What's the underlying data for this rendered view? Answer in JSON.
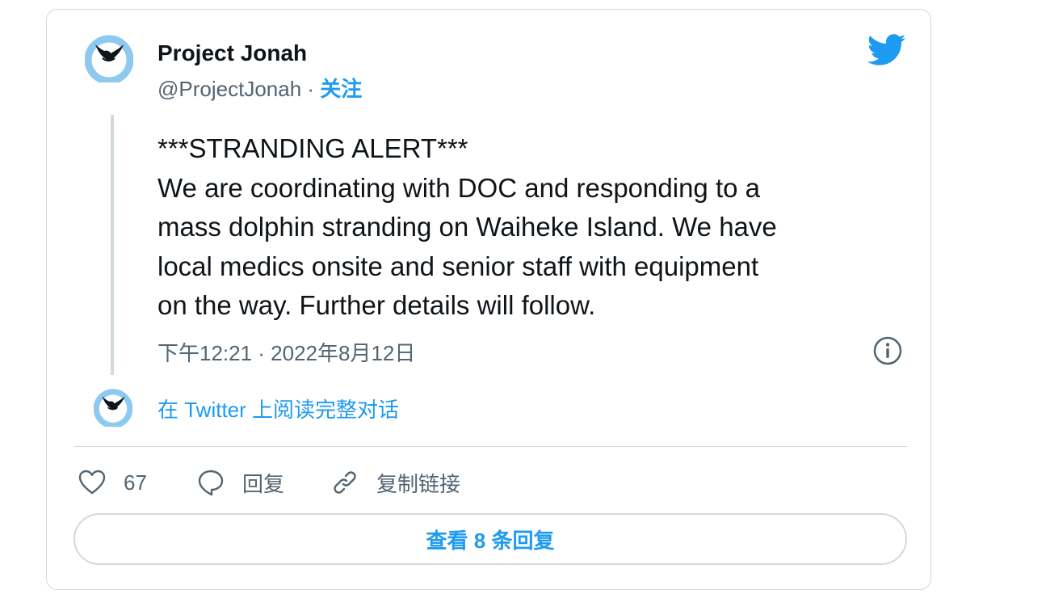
{
  "tweet": {
    "author_name": "Project Jonah",
    "handle": "@ProjectJonah",
    "separator": " · ",
    "follow_label": "关注",
    "text_lines": [
      "***STRANDING ALERT***",
      "We are coordinating with DOC and responding to a",
      "mass dolphin stranding on Waiheke Island. We have",
      "local medics onsite and senior staff with equipment",
      "on the way. Further details will follow."
    ],
    "timestamp": "下午12:21 · 2022年8月12日",
    "read_more": "在 Twitter 上阅读完整对话",
    "actions": {
      "like_count": "67",
      "reply_label": "回复",
      "copy_link_label": "复制链接"
    },
    "view_replies_label": "查看 8 条回复"
  },
  "colors": {
    "accent": "#1d9bf0",
    "text_primary": "#0f1419",
    "text_secondary": "#536471",
    "border": "#cfd9de",
    "avatar_ring": "#8ec9f0"
  },
  "icons": {
    "brand": "twitter-bird-icon",
    "info": "info-icon",
    "like": "heart-icon",
    "reply": "speech-bubble-icon",
    "copy": "link-icon"
  }
}
